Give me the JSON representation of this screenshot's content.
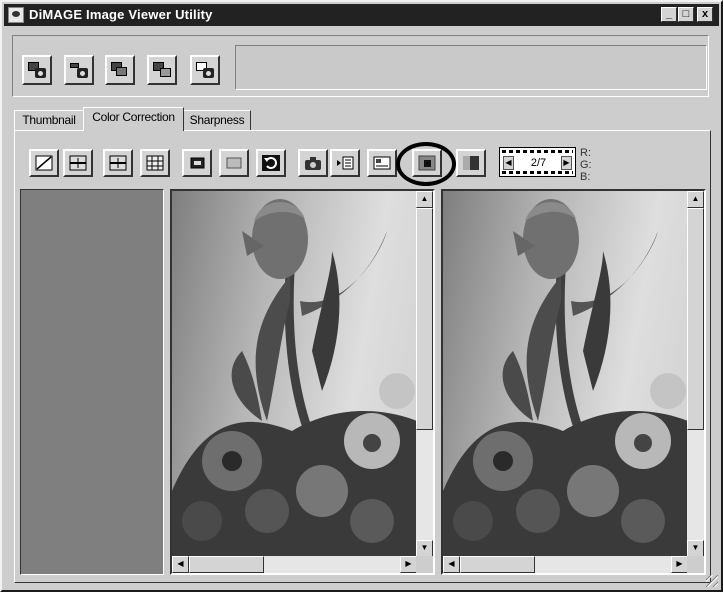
{
  "window": {
    "title": "DiMAGE Image Viewer Utility",
    "controls": {
      "minimize": "_",
      "maximize": "□",
      "close": "x"
    }
  },
  "toolbar_icons": [
    "save-to-card-icon",
    "camera-transfer-icon",
    "card-copy-icon",
    "import-icon",
    "camera-image-icon"
  ],
  "tabs": [
    {
      "label": "Thumbnail",
      "active": false
    },
    {
      "label": "Color Correction",
      "active": true
    },
    {
      "label": "Sharpness",
      "active": false
    }
  ],
  "tools": [
    "tone-curve-icon",
    "compare-split-icon",
    "compare-split-alt-icon",
    "grid-icon",
    "rotate-left-icon",
    "frame-icon",
    "undo-icon",
    "camera-icon",
    "apply-to-image-icon",
    "settings-icon",
    "single-view-icon",
    "before-after-icon"
  ],
  "frame_counter": {
    "value": "2/7",
    "prev": "◀",
    "next": "▶"
  },
  "rgb_readout": {
    "r": "R:",
    "g": "G:",
    "b": "B:"
  },
  "scroll_glyphs": {
    "up": "▲",
    "down": "▼",
    "left": "◀",
    "right": "▶"
  },
  "accent_colors": {
    "title_bar": "#222222",
    "face": "#cdcdcd",
    "left_pane": "#7f7f7f"
  }
}
